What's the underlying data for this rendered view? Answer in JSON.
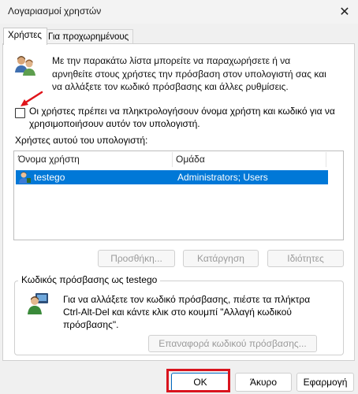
{
  "window": {
    "title": "Λογαριασμοί χρηστών",
    "close_glyph": "✕"
  },
  "tabs": [
    {
      "label": "Χρήστες",
      "active": true
    },
    {
      "label": "Για προχωρημένους",
      "active": false
    }
  ],
  "users_tab": {
    "description": "Με την παρακάτω λίστα μπορείτε να παραχωρήσετε ή να αρνηθείτε στους χρήστες την πρόσβαση στον υπολογιστή σας και να αλλάξετε τον κωδικό πρόσβασης και άλλες ρυθμίσεις.",
    "require_login_checkbox": {
      "label": "Οι χρήστες πρέπει να πληκτρολογήσουν όνομα χρήστη και κωδικό για να χρησιμοποιήσουν αυτόν τον υπολογιστή.",
      "checked": false
    },
    "users_list_label": "Χρήστες αυτού του υπολογιστή:",
    "columns": [
      "Όνομα χρήστη",
      "Ομάδα"
    ],
    "rows": [
      {
        "username": "testego",
        "group": "Administrators; Users",
        "selected": true
      }
    ],
    "buttons": {
      "add": "Προσθήκη...",
      "remove": "Κατάργηση",
      "properties": "Ιδιότητες"
    },
    "password_group": {
      "title": "Κωδικός πρόσβασης ως testego",
      "text": "Για να αλλάξετε τον κωδικό πρόσβασης, πιέστε τα πλήκτρα Ctrl-Alt-Del και κάντε κλικ στο κουμπί \"Αλλαγή κωδικού πρόσβασης\".",
      "reset_button": "Επαναφορά κωδικού πρόσβασης..."
    }
  },
  "footer": {
    "ok": "OK",
    "cancel": "Άκυρο",
    "apply": "Εφαρμογή"
  },
  "colors": {
    "selection": "#0078d7",
    "highlight_box": "#d9141e",
    "annotation_arrow": "#e0141a"
  },
  "icons": [
    "users-icon",
    "annotation-arrow-icon",
    "user-icon",
    "password-user-icon"
  ]
}
